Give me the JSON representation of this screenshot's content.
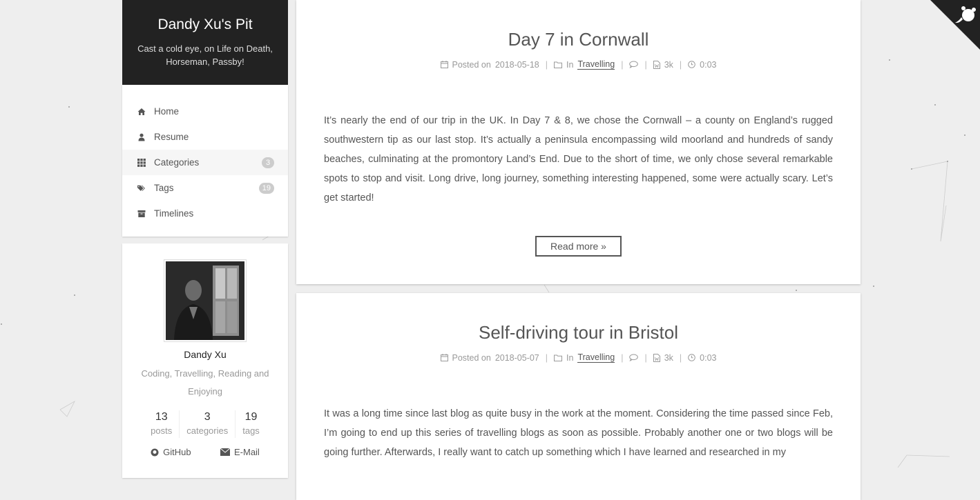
{
  "site": {
    "title": "Dandy Xu's Pit",
    "subtitle": "Cast a cold eye, on Life on Death, Horseman, Passby!"
  },
  "menu": [
    {
      "label": "Home",
      "icon": "home-icon"
    },
    {
      "label": "Resume",
      "icon": "user-icon"
    },
    {
      "label": "Categories",
      "icon": "grid-icon",
      "badge": "3",
      "active": true
    },
    {
      "label": "Tags",
      "icon": "tags-icon",
      "badge": "19"
    },
    {
      "label": "Timelines",
      "icon": "archive-icon"
    }
  ],
  "profile": {
    "name": "Dandy Xu",
    "description": "Coding, Travelling, Reading and Enjoying",
    "stats": [
      {
        "count": "13",
        "label": "posts"
      },
      {
        "count": "3",
        "label": "categories"
      },
      {
        "count": "19",
        "label": "tags"
      }
    ],
    "links": [
      {
        "label": "GitHub",
        "icon": "github-icon"
      },
      {
        "label": "E-Mail",
        "icon": "envelope-icon"
      }
    ]
  },
  "posts": [
    {
      "title": "Day 7 in Cornwall",
      "posted_label": "Posted on",
      "date": "2018-05-18",
      "in_label": "In",
      "category": "Travelling",
      "words": "3k",
      "read_time": "0:03",
      "excerpt": "It’s nearly the end of our trip in the UK. In Day 7 & 8, we chose the Cornwall – a county on England’s rugged southwestern tip as our last stop. It’s actually a peninsula encompassing wild moorland and hundreds of sandy beaches, culminating at the promontory Land’s End. Due to the short of time, we only chose several remarkable spots to stop and visit. Long drive, long journey, something interesting happened, some were actually scary. Let’s get started!",
      "read_more": "Read more »"
    },
    {
      "title": "Self-driving tour in Bristol",
      "posted_label": "Posted on",
      "date": "2018-05-07",
      "in_label": "In",
      "category": "Travelling",
      "words": "3k",
      "read_time": "0:03",
      "excerpt": "It was a long time since last blog as quite busy in the work at the moment. Considering the time passed since Feb, I’m going to end up this series of travelling blogs as soon as possible. Probably another one or two blogs will be going further. Afterwards, I really want to catch up something which I have learned and researched in my"
    }
  ],
  "colors": {
    "header_bg": "#222222",
    "page_bg": "#eeeeee",
    "text": "#555555",
    "badge": "#cccccc"
  }
}
